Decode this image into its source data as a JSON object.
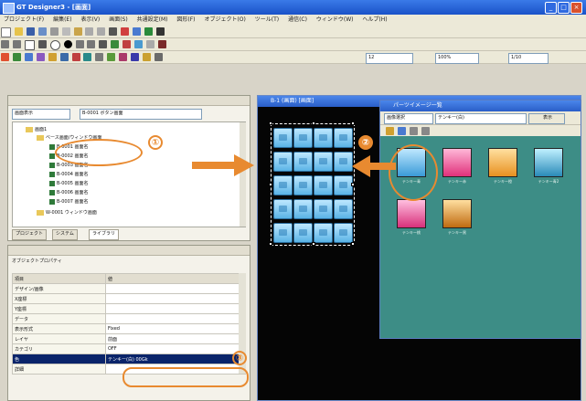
{
  "window": {
    "title": "GT Designer3 - [画面]"
  },
  "menu": [
    "プロジェクト(F)",
    "編集(E)",
    "表示(V)",
    "画面(S)",
    "共通設定(M)",
    "図形(F)",
    "オブジェクト(O)",
    "ツール(T)",
    "通信(C)",
    "ウィンドウ(W)",
    "ヘルプ(H)"
  ],
  "toolbar3": {
    "combo1": "12",
    "combo2": "100%",
    "combo3": "1/10"
  },
  "project_panel": {
    "dropdown1": "画面表示",
    "dropdown2": "B-0001 ボタン画面",
    "tree": [
      "画面1",
      "ベース画面/ウィンドウ画面",
      "B-0001 画面名",
      "B-0002 画面名",
      "B-0003 画面名",
      "B-0004 画面名",
      "B-0005 画面名",
      "B-0006 画面名",
      "B-0007 画面名",
      "W-0001 ウィンドウ画面"
    ],
    "tabs": [
      "プロジェクト",
      "システム",
      "ライブラリ"
    ]
  },
  "property_panel": {
    "title": "オブジェクトプロパティ",
    "col_key": "項目",
    "col_value": "値",
    "rows": [
      {
        "k": "デザイン/画像",
        "v": ""
      },
      {
        "k": "X座標",
        "v": ""
      },
      {
        "k": "Y座標",
        "v": ""
      },
      {
        "k": "データ",
        "v": ""
      },
      {
        "k": "表示形式",
        "v": "Fixed"
      },
      {
        "k": "レイヤ",
        "v": "前面"
      },
      {
        "k": "カテゴリ",
        "v": "OFF"
      },
      {
        "k": "色",
        "v": "テンキー(白)  00Gk",
        "selected": true
      },
      {
        "k": "詳細",
        "v": ""
      }
    ]
  },
  "canvas": {
    "title": "B-1 (画面) [画面]"
  },
  "parts_window": {
    "title": "パーツイメージ一覧",
    "dropdown1": "画像選択",
    "dropdown2": "テンキー(白)",
    "button": "表示",
    "thumbs": [
      "テンキー青",
      "テンキー赤",
      "テンキー橙",
      "テンキー青2",
      "テンキー桃",
      "テンキー黒"
    ]
  },
  "annotations": {
    "n1": "①",
    "n2": "②",
    "n3": "③"
  },
  "colors": {
    "accent": "#e88a30",
    "titlebar": "#2a5ec8",
    "parts_bg": "#3d8d86"
  }
}
